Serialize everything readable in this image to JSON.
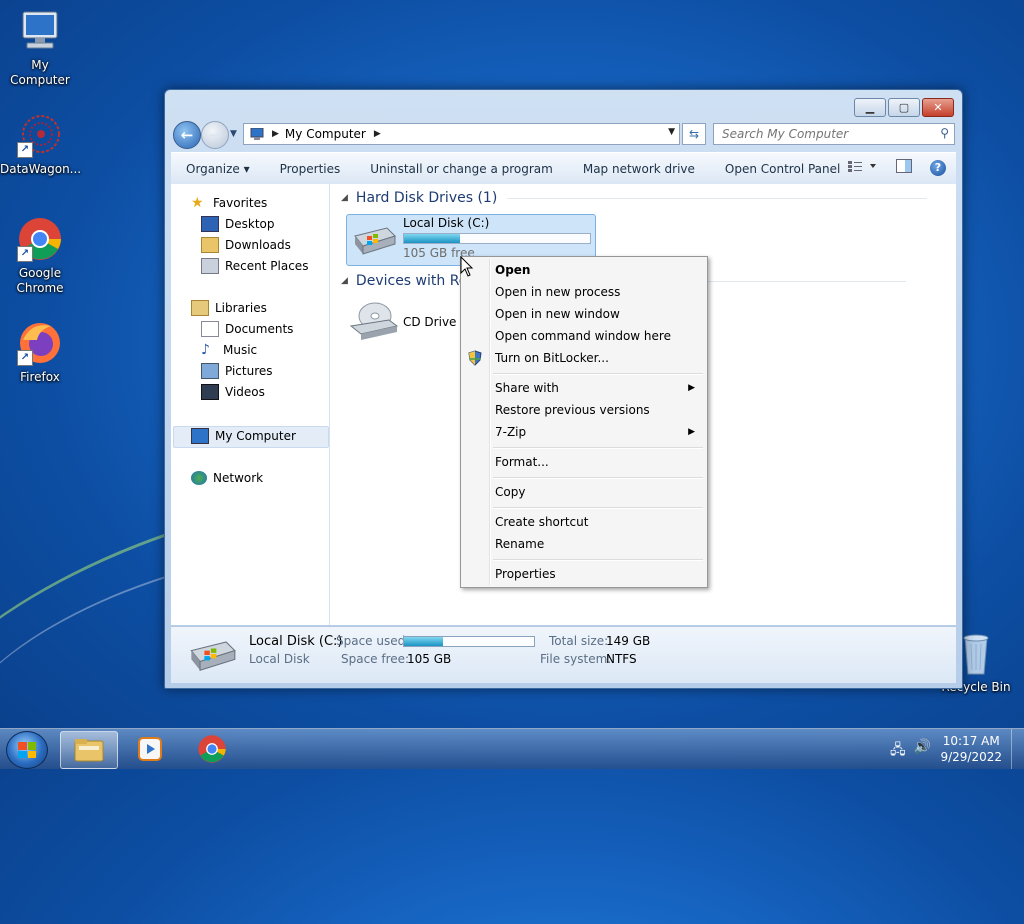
{
  "desktop": {
    "icons": [
      {
        "label": "My Computer",
        "icon": "computer-icon"
      },
      {
        "label": "DataWagon...",
        "icon": "datawagon-icon"
      },
      {
        "label": "Google Chrome",
        "icon": "chrome-icon"
      },
      {
        "label": "Firefox",
        "icon": "firefox-icon"
      },
      {
        "label": "Recycle Bin",
        "icon": "recycle-bin-icon"
      }
    ]
  },
  "window": {
    "address": {
      "location": "My Computer"
    },
    "search": {
      "placeholder": "Search My Computer"
    },
    "commands": [
      "Organize ▾",
      "Properties",
      "Uninstall or change a program",
      "Map network drive",
      "Open Control Panel"
    ],
    "nav": {
      "favorites": "Favorites",
      "favorites_items": [
        "Desktop",
        "Downloads",
        "Recent Places"
      ],
      "libraries": "Libraries",
      "libraries_items": [
        "Documents",
        "Music",
        "Pictures",
        "Videos"
      ],
      "computer": "My Computer",
      "network": "Network"
    },
    "groups": {
      "hard_disk": "Hard Disk Drives (1)",
      "removable": "Devices with Ren"
    },
    "drive": {
      "name": "Local Disk (C:)",
      "free_text": "105 GB free",
      "used_fraction": 0.3
    },
    "cd": {
      "name": "CD Drive (D"
    },
    "details": {
      "name": "Local Disk (C:)",
      "type": "Local Disk",
      "space_used_label": "Space used:",
      "space_free_label": "Space free:",
      "space_free": "105 GB",
      "total_size_label": "Total size:",
      "total_size": "149 GB",
      "file_system_label": "File system:",
      "file_system": "NTFS"
    }
  },
  "context_menu": {
    "items": [
      "Open",
      "Open in new process",
      "Open in new window",
      "Open command window here",
      "Turn on BitLocker...",
      "Share with",
      "Restore previous versions",
      "7-Zip",
      "Format...",
      "Copy",
      "Create shortcut",
      "Rename",
      "Properties"
    ]
  },
  "taskbar": {
    "time": "10:17 AM",
    "date": "9/29/2022"
  },
  "colors": {
    "accent": "#1a93c4",
    "selection": "#cde4f9",
    "heading": "#1e3c73"
  }
}
